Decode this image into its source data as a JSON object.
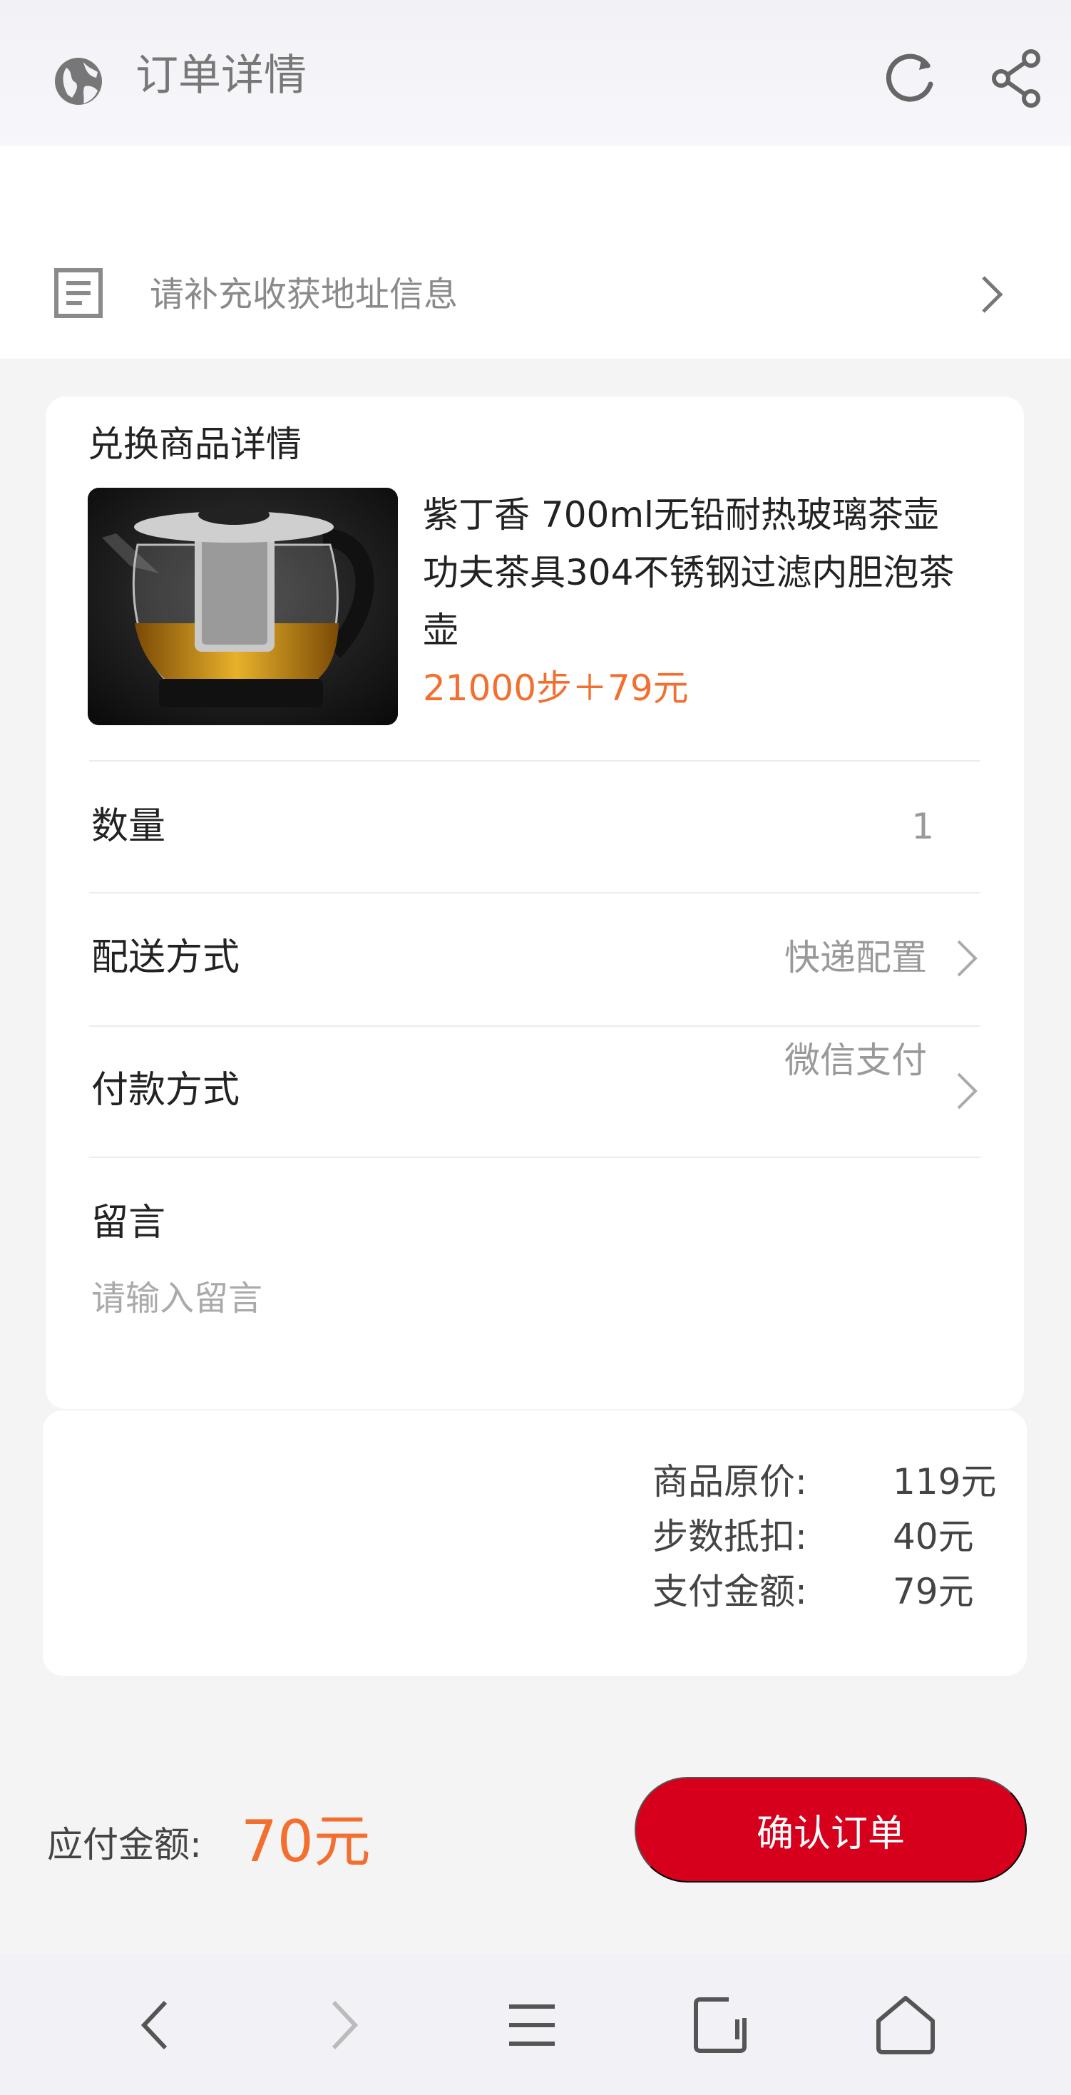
{
  "header": {
    "title": "订单详情",
    "left_icon": "globe-icon",
    "right_icons": [
      "refresh-icon",
      "share-icon"
    ]
  },
  "address": {
    "icon": "document-icon",
    "text": "请补充收获地址信息"
  },
  "product": {
    "section_title": "兑换商品详情",
    "name": "紫丁香 700ml无铅耐热玻璃茶壶功夫茶具304不锈钢过滤内胆泡茶壶",
    "price": "21000步＋79元"
  },
  "rows": {
    "quantity": {
      "label": "数量",
      "value": "1"
    },
    "delivery": {
      "label": "配送方式",
      "value": "快递配置"
    },
    "payment": {
      "label": "付款方式",
      "value": "微信支付"
    },
    "message": {
      "label": "留言",
      "placeholder": "请输入留言"
    }
  },
  "summary": {
    "original_label": "商品原价:",
    "original_value": "119元",
    "deduct_label": "步数抵扣:",
    "deduct_value": "40元",
    "pay_label": "支付金额:",
    "pay_value": "79元"
  },
  "footer": {
    "due_label": "应付金额:",
    "due_value": "70元",
    "confirm_button": "确认订单"
  },
  "browser_nav": [
    "back-icon",
    "forward-icon",
    "menu-icon",
    "tabs-icon",
    "home-icon"
  ],
  "colors": {
    "accent_orange": "#f36f2f",
    "confirm_red": "#d6001c",
    "background": "#f4f4f5"
  }
}
